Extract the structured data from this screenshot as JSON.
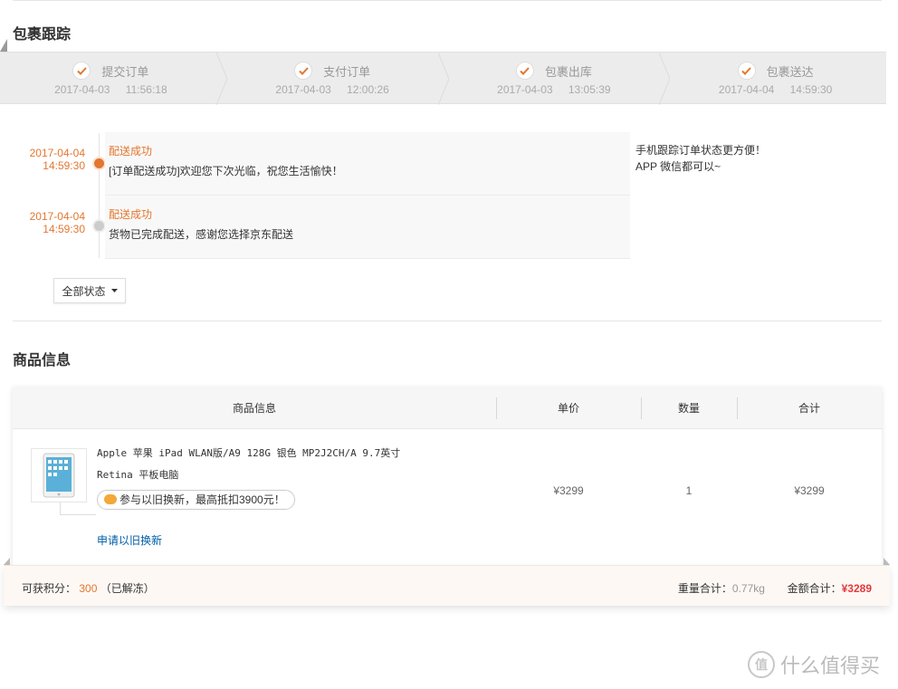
{
  "tracking": {
    "title": "包裹跟踪",
    "steps": [
      {
        "label": "提交订单",
        "time": "2017-04-03 11:56:18"
      },
      {
        "label": "支付订单",
        "time": "2017-04-03 12:00:26"
      },
      {
        "label": "包裹出库",
        "time": "2017-04-03 13:05:39"
      },
      {
        "label": "包裹送达",
        "time": "2017-04-04 14:59:30"
      }
    ],
    "events": [
      {
        "date": "2017-04-04",
        "time": "14:59:30",
        "status": "配送成功",
        "desc": "[订单配送成功]欢迎您下次光临，祝您生活愉快！"
      },
      {
        "date": "2017-04-04",
        "time": "14:59:30",
        "status": "配送成功",
        "desc": "货物已完成配送，感谢您选择京东配送"
      }
    ],
    "side_tip_1": "手机跟踪订单状态更方便！",
    "side_tip_2": "APP 微信都可以~",
    "filter_label": "全部状态"
  },
  "product": {
    "title": "商品信息",
    "headers": {
      "info": "商品信息",
      "price": "单价",
      "qty": "数量",
      "total": "合计"
    },
    "name_line1": "Apple 苹果 iPad WLAN版/A9 128G 银色 MP2J2CH/A 9.7英寸",
    "name_line2": "Retina 平板电脑",
    "promo": "参与以旧换新，最高抵扣3900元！",
    "trade_in_link": "申请以旧换新",
    "price": "¥3299",
    "qty": "1",
    "total": "¥3299"
  },
  "summary": {
    "points_label": "可获积分：",
    "points_value": "300",
    "points_note": "（已解冻）",
    "weight_label": "重量合计：",
    "weight_value": "0.77kg",
    "amount_label": "金额合计：",
    "amount_value": "¥3289"
  },
  "watermark": "什么值得买",
  "colors": {
    "accent": "#e4762f",
    "price_red": "#e4393c",
    "link": "#005ea7"
  }
}
